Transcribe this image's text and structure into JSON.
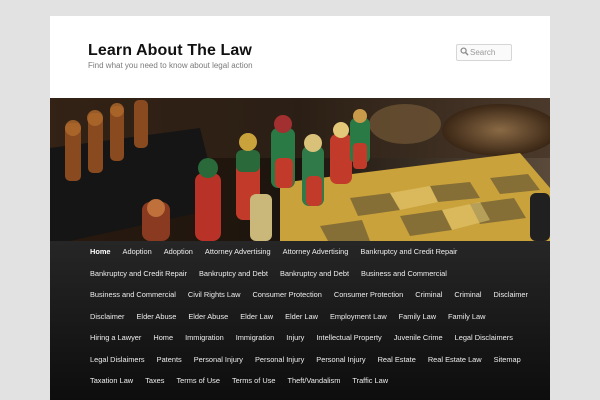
{
  "site": {
    "title": "Learn About The Law",
    "description": "Find what you need to know about legal action"
  },
  "search": {
    "placeholder": "Search",
    "icon": "search-icon"
  },
  "hero": {
    "subject": "chess board with carved chess pieces"
  },
  "colors": {
    "page_background": "#e2e2e2",
    "nav_background": "#1a1a1a",
    "nav_text": "#eeeeee"
  },
  "nav": {
    "current": "Home",
    "items": [
      "Home",
      "Adoption",
      "Adoption",
      "Attorney Advertising",
      "Attorney Advertising",
      "Bankruptcy and Credit Repair",
      "Bankruptcy and Credit Repair",
      "Bankruptcy and Debt",
      "Bankruptcy and Debt",
      "Business and Commercial",
      "Business and Commercial",
      "Civil Rights Law",
      "Consumer Protection",
      "Consumer Protection",
      "Criminal",
      "Criminal",
      "Disclaimer",
      "Disclaimer",
      "Elder Abuse",
      "Elder Abuse",
      "Elder Law",
      "Elder Law",
      "Employment Law",
      "Family Law",
      "Family Law",
      "Hiring a Lawyer",
      "Home",
      "Immigration",
      "Immigration",
      "Injury",
      "Intellectual Property",
      "Juvenile Crime",
      "Legal Disclaimers",
      "Legal Dislaimers",
      "Patents",
      "Personal Injury",
      "Personal Injury",
      "Personal Injury",
      "Real Estate",
      "Real Estate Law",
      "Sitemap",
      "Taxation Law",
      "Taxes",
      "Terms of Use",
      "Terms of Use",
      "Theft/Vandalism",
      "Traffic Law"
    ]
  }
}
